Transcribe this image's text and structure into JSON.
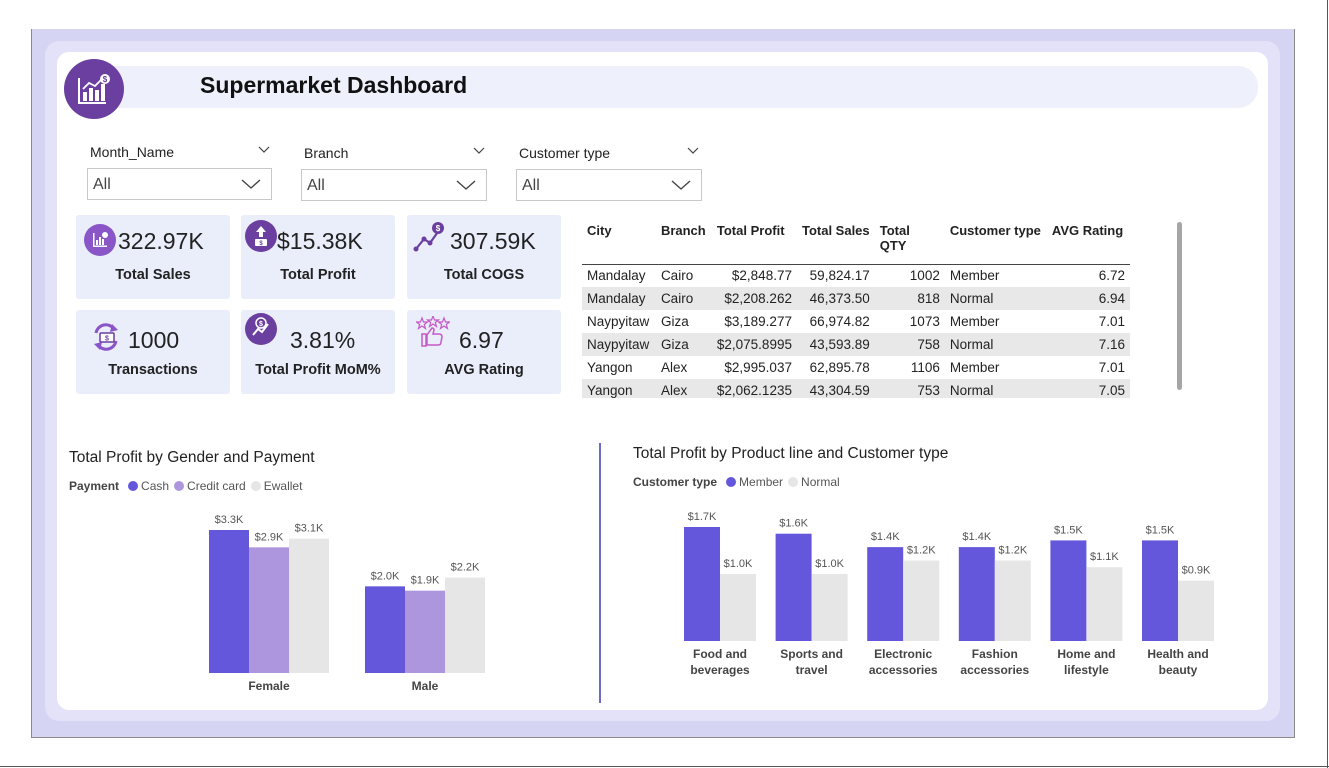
{
  "header": {
    "title": "Supermarket Dashboard",
    "logo_icon": "growth-chart-icon"
  },
  "slicers": [
    {
      "label": "Month_Name",
      "value": "All"
    },
    {
      "label": "Branch",
      "value": "All"
    },
    {
      "label": "Customer type",
      "value": "All"
    }
  ],
  "kpis": [
    {
      "value": "322.97K",
      "label": "Total Sales",
      "icon": "sales-chart-icon"
    },
    {
      "value": "$15.38K",
      "label": "Total Profit",
      "icon": "profit-icon"
    },
    {
      "value": "307.59K",
      "label": "Total COGS",
      "icon": "cogs-icon"
    },
    {
      "value": "1000",
      "label": "Transactions",
      "icon": "transactions-icon"
    },
    {
      "value": "3.81%",
      "label": "Total Profit MoM%",
      "icon": "growth-icon"
    },
    {
      "value": "6.97",
      "label": "AVG Rating",
      "icon": "rating-icon"
    }
  ],
  "table": {
    "headers": [
      "City",
      "Branch",
      "Total Profit",
      "Total Sales",
      "Total QTY",
      "Customer type",
      "AVG Rating"
    ],
    "rows": [
      [
        "Mandalay",
        "Cairo",
        "$2,848.77",
        "59,824.17",
        "1002",
        "Member",
        "6.72"
      ],
      [
        "Mandalay",
        "Cairo",
        "$2,208.262",
        "46,373.50",
        "818",
        "Normal",
        "6.94"
      ],
      [
        "Naypyitaw",
        "Giza",
        "$3,189.277",
        "66,974.82",
        "1073",
        "Member",
        "7.01"
      ],
      [
        "Naypyitaw",
        "Giza",
        "$2,075.8995",
        "43,593.89",
        "758",
        "Normal",
        "7.16"
      ],
      [
        "Yangon",
        "Alex",
        "$2,995.037",
        "62,895.78",
        "1106",
        "Member",
        "7.01"
      ],
      [
        "Yangon",
        "Alex",
        "$2,062.1235",
        "43,304.59",
        "753",
        "Normal",
        "7.05"
      ]
    ]
  },
  "colors": {
    "accent": "#6b3fa0",
    "series1": "#6457dc",
    "series2": "#ad96dd",
    "series3": "#e6e6e6"
  },
  "chart_data": [
    {
      "type": "bar",
      "title": "Total Profit by Gender and Payment",
      "legend_title": "Payment",
      "legend_position": "top-left",
      "categories": [
        "Female",
        "Male"
      ],
      "series": [
        {
          "name": "Cash",
          "color": "#6457dc",
          "values": [
            3300,
            2000
          ],
          "labels": [
            "$3.3K",
            "$2.0K"
          ]
        },
        {
          "name": "Credit card",
          "color": "#ad96dd",
          "values": [
            2900,
            1900
          ],
          "labels": [
            "$2.9K",
            "$1.9K"
          ]
        },
        {
          "name": "Ewallet",
          "color": "#e6e6e6",
          "values": [
            3100,
            2200
          ],
          "labels": [
            "$3.1K",
            "$2.2K"
          ]
        }
      ],
      "ylim": [
        0,
        3300
      ]
    },
    {
      "type": "bar",
      "title": "Total Profit by Product line and Customer type",
      "legend_title": "Customer type",
      "legend_position": "top-left",
      "categories": [
        [
          "Food and",
          "beverages"
        ],
        [
          "Sports and",
          "travel"
        ],
        [
          "Electronic",
          "accessories"
        ],
        [
          "Fashion",
          "accessories"
        ],
        [
          "Home and",
          "lifestyle"
        ],
        [
          "Health and",
          "beauty"
        ]
      ],
      "series": [
        {
          "name": "Member",
          "color": "#6457dc",
          "values": [
            1700,
            1600,
            1400,
            1400,
            1500,
            1500
          ],
          "labels": [
            "$1.7K",
            "$1.6K",
            "$1.4K",
            "$1.4K",
            "$1.5K",
            "$1.5K"
          ]
        },
        {
          "name": "Normal",
          "color": "#e6e6e6",
          "values": [
            1000,
            1000,
            1200,
            1200,
            1100,
            900
          ],
          "labels": [
            "$1.0K",
            "$1.0K",
            "$1.2K",
            "$1.2K",
            "$1.1K",
            "$0.9K"
          ]
        }
      ],
      "ylim": [
        0,
        1700
      ]
    }
  ]
}
